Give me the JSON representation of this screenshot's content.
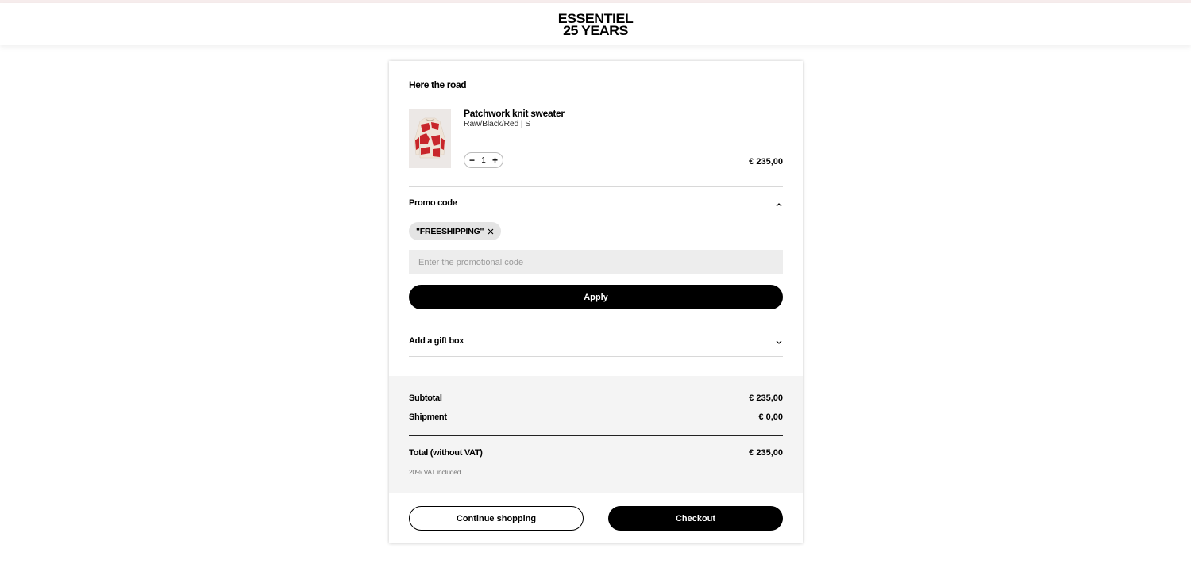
{
  "brand": {
    "logo_line1": "ESSENTIEL",
    "logo_line2": "25 YEARS"
  },
  "cart": {
    "title": "Here the road",
    "item": {
      "name": "Patchwork knit sweater",
      "variant": "Raw/Black/Red | S",
      "quantity": "1",
      "decrement_label": "−",
      "increment_label": "+",
      "price": "€ 235,00",
      "image_icon": "sweater-thumbnail",
      "image_colors": {
        "base": "#efe4d8",
        "accent": "#c8262b"
      }
    }
  },
  "promo": {
    "title": "Promo code",
    "applied_code": "\"FREESHIPPING\"",
    "input_placeholder": "Enter the promotional code",
    "input_value": "",
    "apply_label": "Apply",
    "expanded_icon": "chevron-up-icon"
  },
  "gift": {
    "title": "Add a gift box",
    "collapsed_icon": "chevron-down-icon"
  },
  "summary": {
    "subtotal_label": "Subtotal",
    "subtotal_value": "€ 235,00",
    "shipment_label": "Shipment",
    "shipment_value": "€ 0,00",
    "total_label": "Total (without VAT)",
    "total_value": "€ 235,00",
    "vat_note": "20% VAT included"
  },
  "actions": {
    "continue_label": "Continue shopping",
    "checkout_label": "Checkout"
  },
  "colors": {
    "primary": "#000000",
    "summary_bg": "#f4f4f4",
    "chip_bg": "#e4e4e4",
    "input_bg": "#ededed"
  }
}
